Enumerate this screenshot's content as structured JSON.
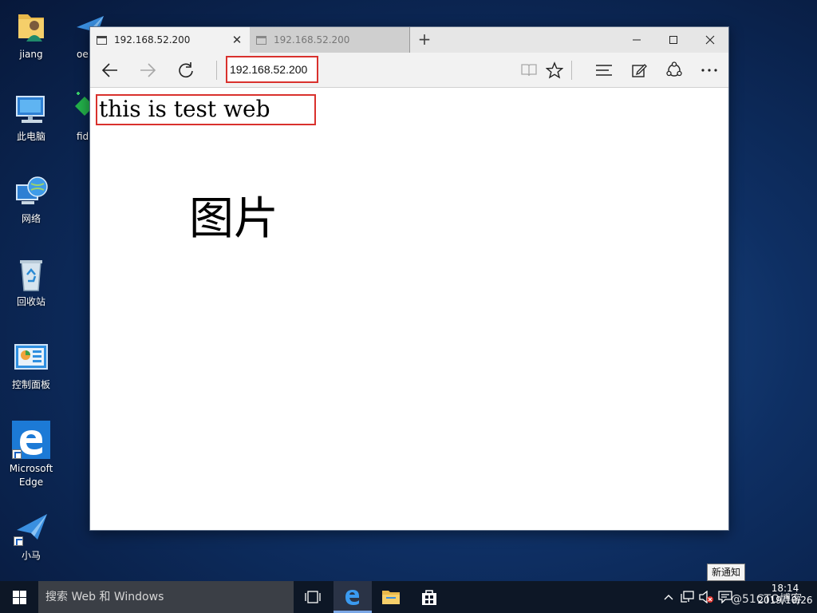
{
  "desktop": {
    "icons": [
      {
        "label": "jiang"
      },
      {
        "label": "此电脑"
      },
      {
        "label": "网络"
      },
      {
        "label": "回收站"
      },
      {
        "label": "控制面板"
      },
      {
        "label": "Microsoft Edge"
      },
      {
        "label": "小马"
      }
    ],
    "partial_icons": [
      {
        "label": "oe"
      },
      {
        "label": "fid"
      }
    ]
  },
  "browser": {
    "tabs": [
      {
        "title": "192.168.52.200",
        "active": true
      },
      {
        "title": "192.168.52.200",
        "active": false
      }
    ],
    "new_tab_label": "+",
    "address": "192.168.52.200",
    "page": {
      "text": "this is test web",
      "image_alt": "图片"
    }
  },
  "taskbar": {
    "search_placeholder": "搜索 Web 和 Windows",
    "clock_time": "18:14",
    "clock_date": "2019/10/26",
    "tooltip": "新通知",
    "watermark": "@51CTO博客"
  },
  "colors": {
    "highlight_box": "#d9312d",
    "edge_blue": "#1c7ad6",
    "taskbar": "#0d1726"
  }
}
